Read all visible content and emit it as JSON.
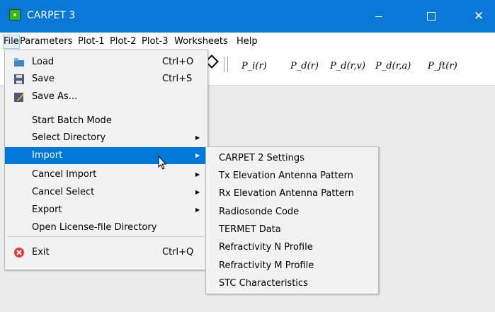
{
  "window": {
    "title": "CARPET 3",
    "minimize_icon": "minimize-icon",
    "maximize_icon": "maximize-icon",
    "close_icon": "close-icon"
  },
  "menubar": [
    "File",
    "Parameters",
    "Plot-1",
    "Plot-2",
    "Plot-3",
    "Worksheets",
    "Help"
  ],
  "toolbar": {
    "icon": "pencil-icon",
    "labels": [
      "P_i(r)",
      "P_d(r)",
      "P_d(r,v)",
      "P_d(r,a)",
      "P_ft(r)"
    ]
  },
  "file_menu": {
    "items": [
      {
        "label": "Load",
        "shortcut": "Ctrl+O",
        "icon": "folder-open-icon"
      },
      {
        "label": "Save",
        "shortcut": "Ctrl+S",
        "icon": "floppy-disk-icon"
      },
      {
        "label": "Save As...",
        "shortcut": "",
        "icon": "pencil-save-icon"
      },
      {
        "label": "Start Batch Mode",
        "shortcut": ""
      },
      {
        "label": "Select Directory",
        "shortcut": "",
        "submenu": true
      },
      {
        "label": "Import",
        "shortcut": "",
        "submenu": true,
        "highlighted": true
      },
      {
        "label": "Cancel Import",
        "shortcut": "",
        "submenu": true
      },
      {
        "label": "Cancel Select",
        "shortcut": "",
        "submenu": true
      },
      {
        "label": "Export",
        "shortcut": "",
        "submenu": true
      },
      {
        "label": "Open License-file Directory",
        "shortcut": ""
      },
      {
        "label": "Exit",
        "shortcut": "Ctrl+Q",
        "icon": "exit-icon"
      }
    ]
  },
  "import_submenu": [
    "CARPET 2 Settings",
    "Tx Elevation Antenna Pattern",
    "Rx Elevation Antenna Pattern",
    "Radiosonde Code",
    "TERMET Data",
    "Refractivity N Profile",
    "Refractivity M Profile",
    "STC Characteristics"
  ]
}
